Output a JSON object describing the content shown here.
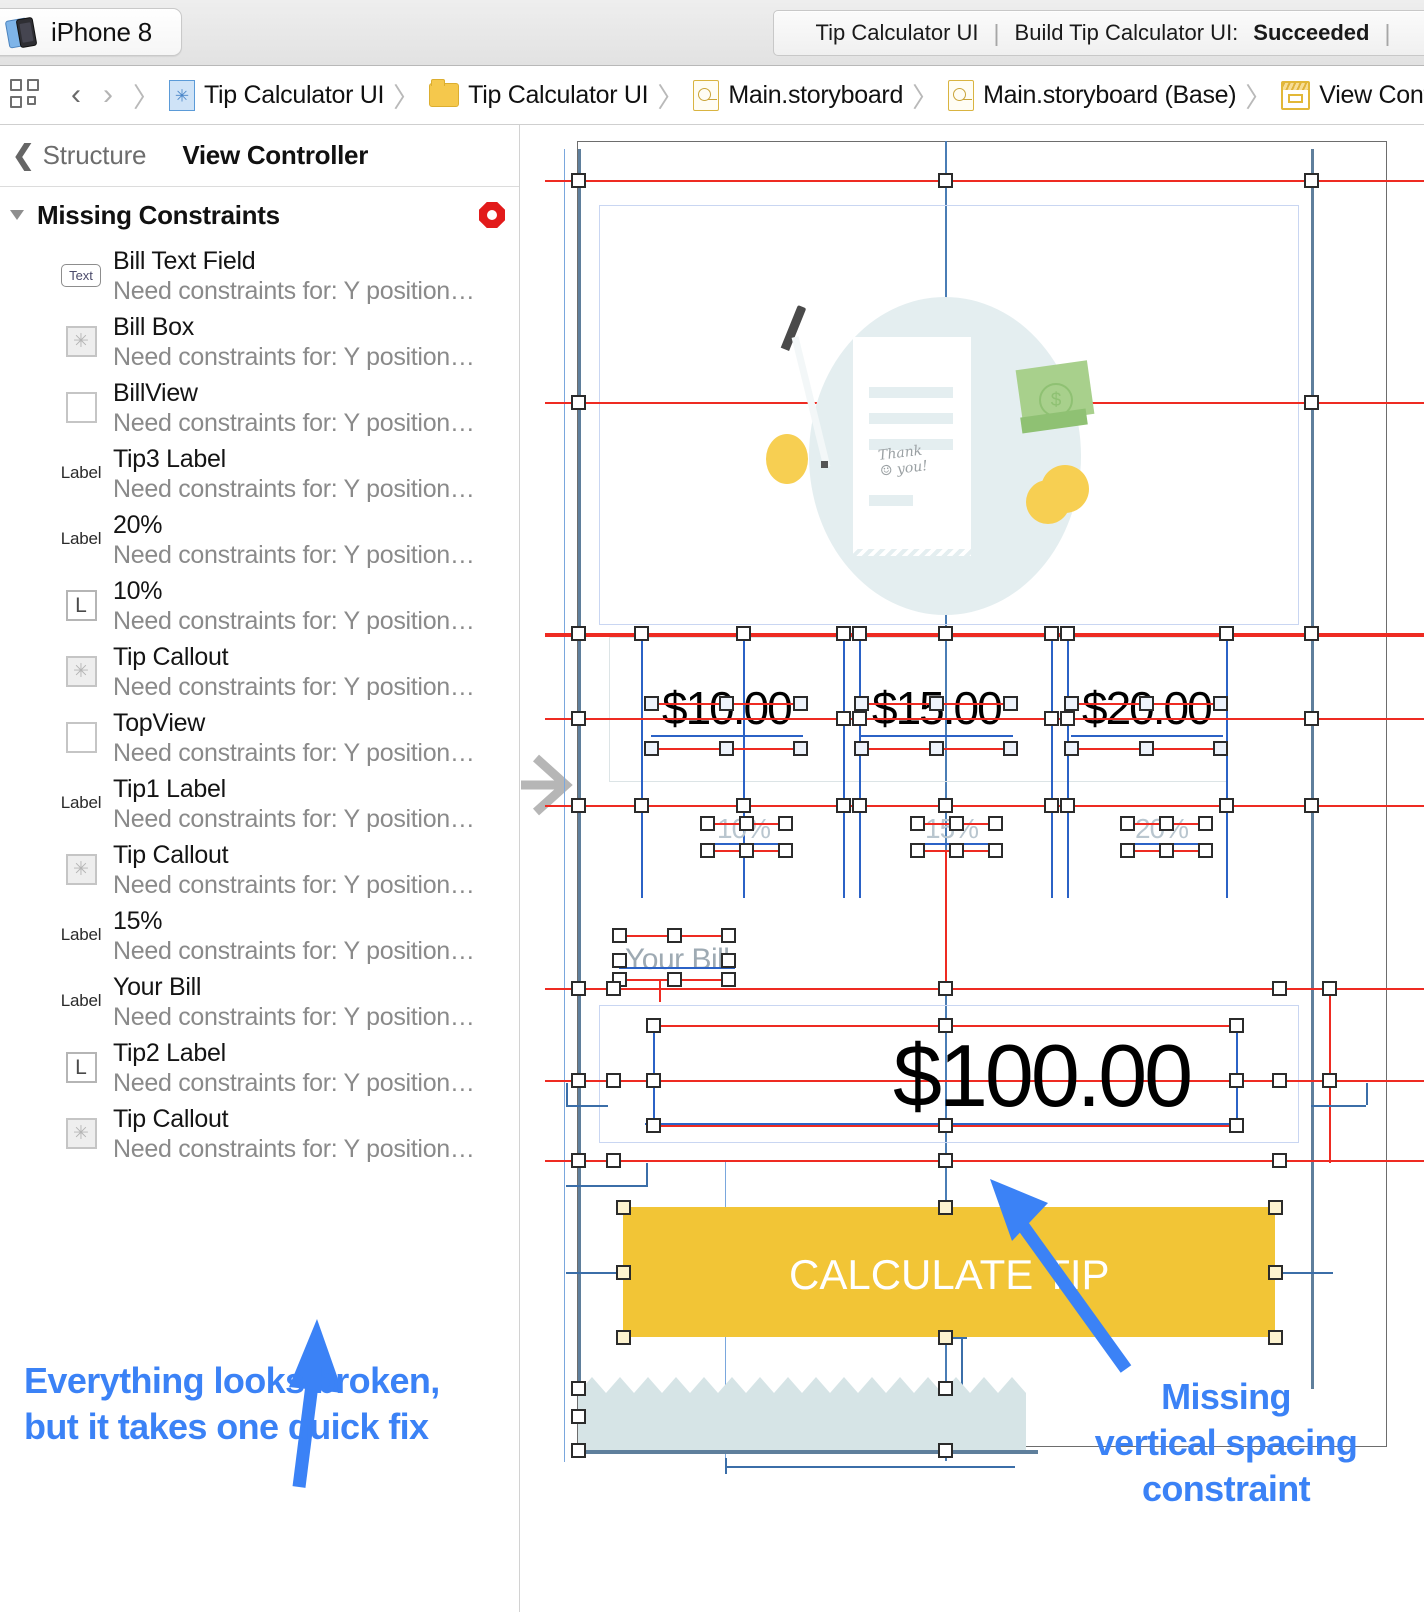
{
  "toolbar": {
    "scheme_prefix": "UI",
    "scheme_chevron": "〉",
    "device_icon": "device-iphone-icon",
    "scheme_name": "iPhone 8",
    "status_project": "Tip Calculator UI",
    "status_separator": "|",
    "status_build_prefix": "Build Tip Calculator UI:",
    "status_build_result": "Succeeded",
    "status_separator2": "|"
  },
  "jumpbar": {
    "grid_icon": "grid-icon",
    "back_arrow": "‹",
    "forward_arrow": "›",
    "separator": "〉",
    "crumbs": [
      {
        "icon": "app-project-icon",
        "label": "Tip Calculator UI"
      },
      {
        "icon": "folder-icon",
        "label": "Tip Calculator UI"
      },
      {
        "icon": "storyboard-file-icon",
        "label": "Main.storyboard"
      },
      {
        "icon": "storyboard-base-icon",
        "label": "Main.storyboard (Base)"
      },
      {
        "icon": "view-controller-scene-icon",
        "label": "View Controller Sce"
      }
    ]
  },
  "sidebar": {
    "back_chevron": "❮",
    "back_label": "Structure",
    "title": "View Controller",
    "group": {
      "label": "Missing Constraints",
      "badge": "error-badge",
      "expanded": true
    },
    "issues": [
      {
        "icon": "text-field-icon",
        "icon_glyph": "Text",
        "name": "Bill Text Field",
        "detail": "Need constraints for: Y position…"
      },
      {
        "icon": "image-view-icon",
        "icon_glyph": "",
        "name": "Bill Box",
        "detail": "Need constraints for: Y position…"
      },
      {
        "icon": "view-icon",
        "icon_glyph": "",
        "name": "BillView",
        "detail": "Need constraints for: Y position…"
      },
      {
        "icon": "label-icon",
        "icon_glyph": "Label",
        "name": "Tip3 Label",
        "detail": "Need constraints for: Y position…"
      },
      {
        "icon": "label-icon",
        "icon_glyph": "Label",
        "name": "20%",
        "detail": "Need constraints for: Y position…"
      },
      {
        "icon": "label-box-icon",
        "icon_glyph": "L",
        "name": "10%",
        "detail": "Need constraints for: Y position…"
      },
      {
        "icon": "image-view-icon",
        "icon_glyph": "",
        "name": "Tip Callout",
        "detail": "Need constraints for: Y position…"
      },
      {
        "icon": "view-icon",
        "icon_glyph": "",
        "name": "TopView",
        "detail": "Need constraints for: Y position…"
      },
      {
        "icon": "label-icon",
        "icon_glyph": "Label",
        "name": "Tip1 Label",
        "detail": "Need constraints for: Y position…"
      },
      {
        "icon": "image-view-icon",
        "icon_glyph": "",
        "name": "Tip Callout",
        "detail": "Need constraints for: Y position…"
      },
      {
        "icon": "label-icon",
        "icon_glyph": "Label",
        "name": "15%",
        "detail": "Need constraints for: Y position…"
      },
      {
        "icon": "label-icon",
        "icon_glyph": "Label",
        "name": "Your Bill",
        "detail": "Need constraints for: Y position…"
      },
      {
        "icon": "label-box-icon",
        "icon_glyph": "L",
        "name": "Tip2 Label",
        "detail": "Need constraints for: Y position…"
      },
      {
        "icon": "image-view-icon",
        "icon_glyph": "",
        "name": "Tip Callout",
        "detail": "Need constraints for: Y position…"
      }
    ]
  },
  "annotations": {
    "left": "Everything looks broken,\nbut it takes one quick fix",
    "right": "Missing\nvertical spacing\nconstraint",
    "color": "#3b82f6"
  },
  "canvas": {
    "illustration": {
      "handwritten_note": "Thank\nyou!",
      "bill_symbol": "$"
    },
    "tip_amounts": [
      "$10.00",
      "$15.00",
      "$20.00"
    ],
    "tip_percents": [
      "10%",
      "15%",
      "20%"
    ],
    "bill_label": "Your Bill",
    "bill_total": "$100.00",
    "calculate_button": "CALCULATE TIP",
    "colors": {
      "button": "#f2c536",
      "constraint_error": "#ee2b22",
      "constraint_ok": "#2b62c6",
      "footer_band": "#d6e4e6"
    }
  }
}
